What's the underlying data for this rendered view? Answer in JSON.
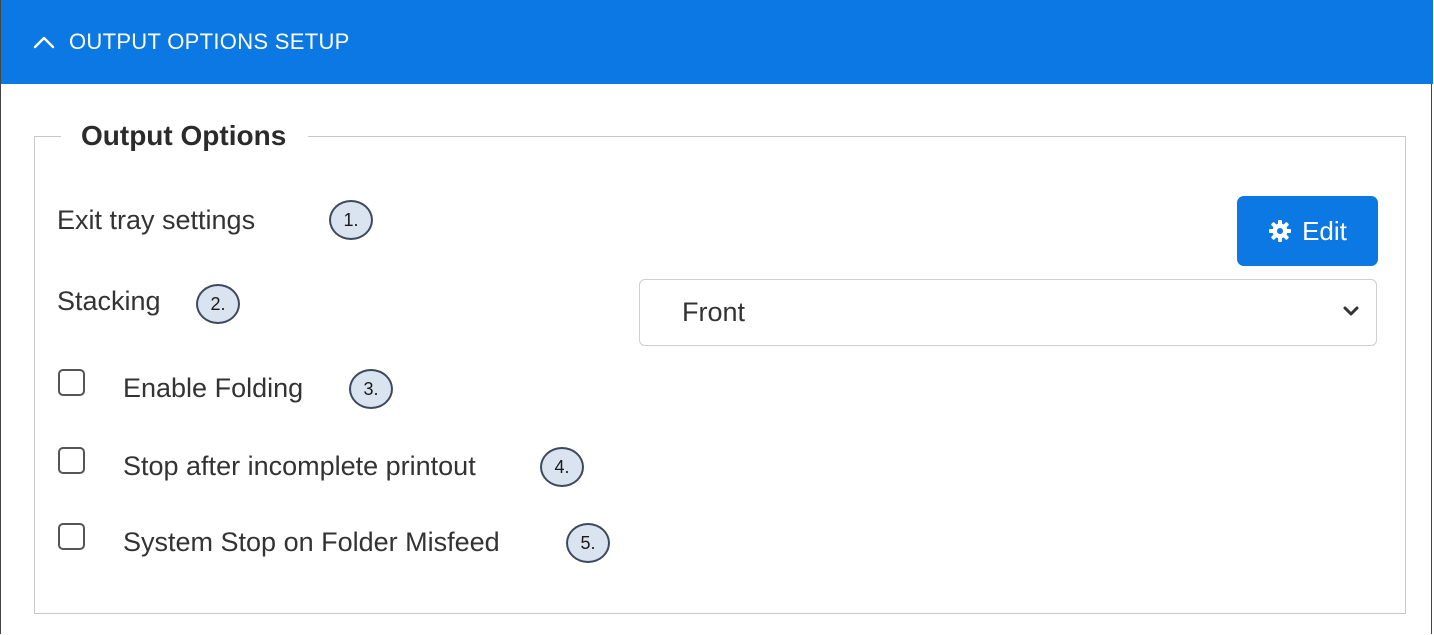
{
  "header": {
    "title": "OUTPUT OPTIONS SETUP",
    "toggle_icon": "chevron-up-icon"
  },
  "group": {
    "legend": "Output Options"
  },
  "exit_tray": {
    "label": "Exit tray settings",
    "badge": "1.",
    "edit_label": "Edit",
    "edit_icon": "gear-icon"
  },
  "stacking": {
    "label": "Stacking",
    "badge": "2.",
    "selected": "Front"
  },
  "checkboxes": [
    {
      "label": "Enable Folding",
      "badge": "3.",
      "checked": false
    },
    {
      "label": "Stop after incomplete printout",
      "badge": "4.",
      "checked": false
    },
    {
      "label": "System Stop on Folder Misfeed",
      "badge": "5.",
      "checked": false
    }
  ],
  "colors": {
    "accent": "#0b78e3",
    "badge_fill": "#dae3f0",
    "badge_border": "#3c4a5c"
  }
}
